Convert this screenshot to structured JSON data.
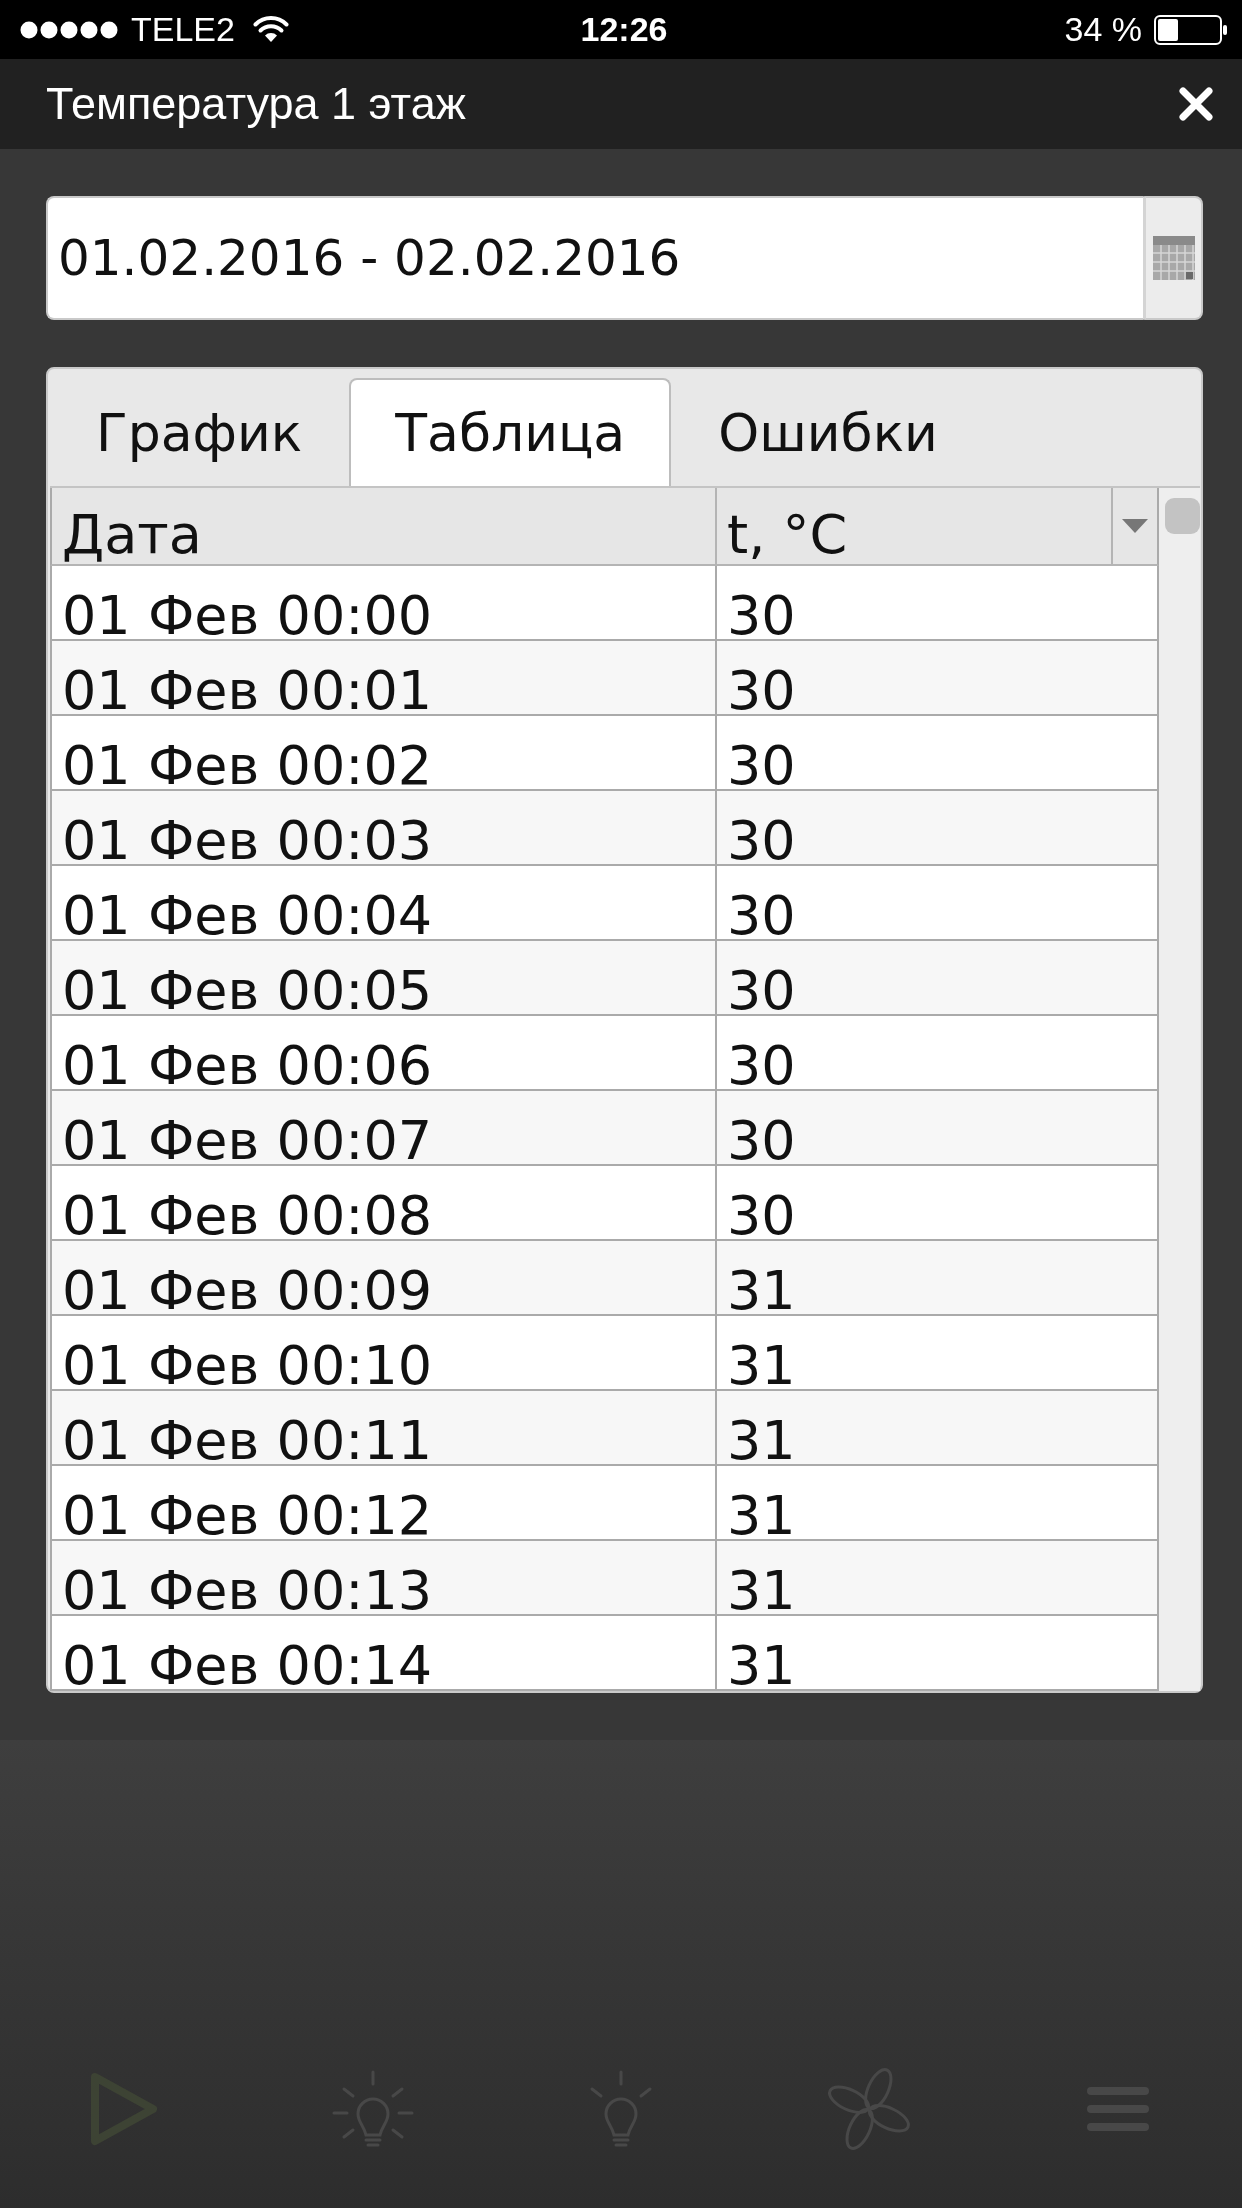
{
  "status_bar": {
    "carrier": "TELE2",
    "time": "12:26",
    "battery": "34 %"
  },
  "window": {
    "title": "Температура 1 этаж"
  },
  "date_range": {
    "value": "01.02.2016 - 02.02.2016"
  },
  "tabs": [
    {
      "label": "График",
      "selected": false
    },
    {
      "label": "Таблица",
      "selected": true
    },
    {
      "label": "Ошибки",
      "selected": false
    }
  ],
  "table": {
    "columns": [
      "Дата",
      "t, °C"
    ],
    "rows": [
      [
        "01 Фев 00:00",
        "30"
      ],
      [
        "01 Фев 00:01",
        "30"
      ],
      [
        "01 Фев 00:02",
        "30"
      ],
      [
        "01 Фев 00:03",
        "30"
      ],
      [
        "01 Фев 00:04",
        "30"
      ],
      [
        "01 Фев 00:05",
        "30"
      ],
      [
        "01 Фев 00:06",
        "30"
      ],
      [
        "01 Фев 00:07",
        "30"
      ],
      [
        "01 Фев 00:08",
        "30"
      ],
      [
        "01 Фев 00:09",
        "31"
      ],
      [
        "01 Фев 00:10",
        "31"
      ],
      [
        "01 Фев 00:11",
        "31"
      ],
      [
        "01 Фев 00:12",
        "31"
      ],
      [
        "01 Фев 00:13",
        "31"
      ],
      [
        "01 Фев 00:14",
        "31"
      ]
    ]
  }
}
